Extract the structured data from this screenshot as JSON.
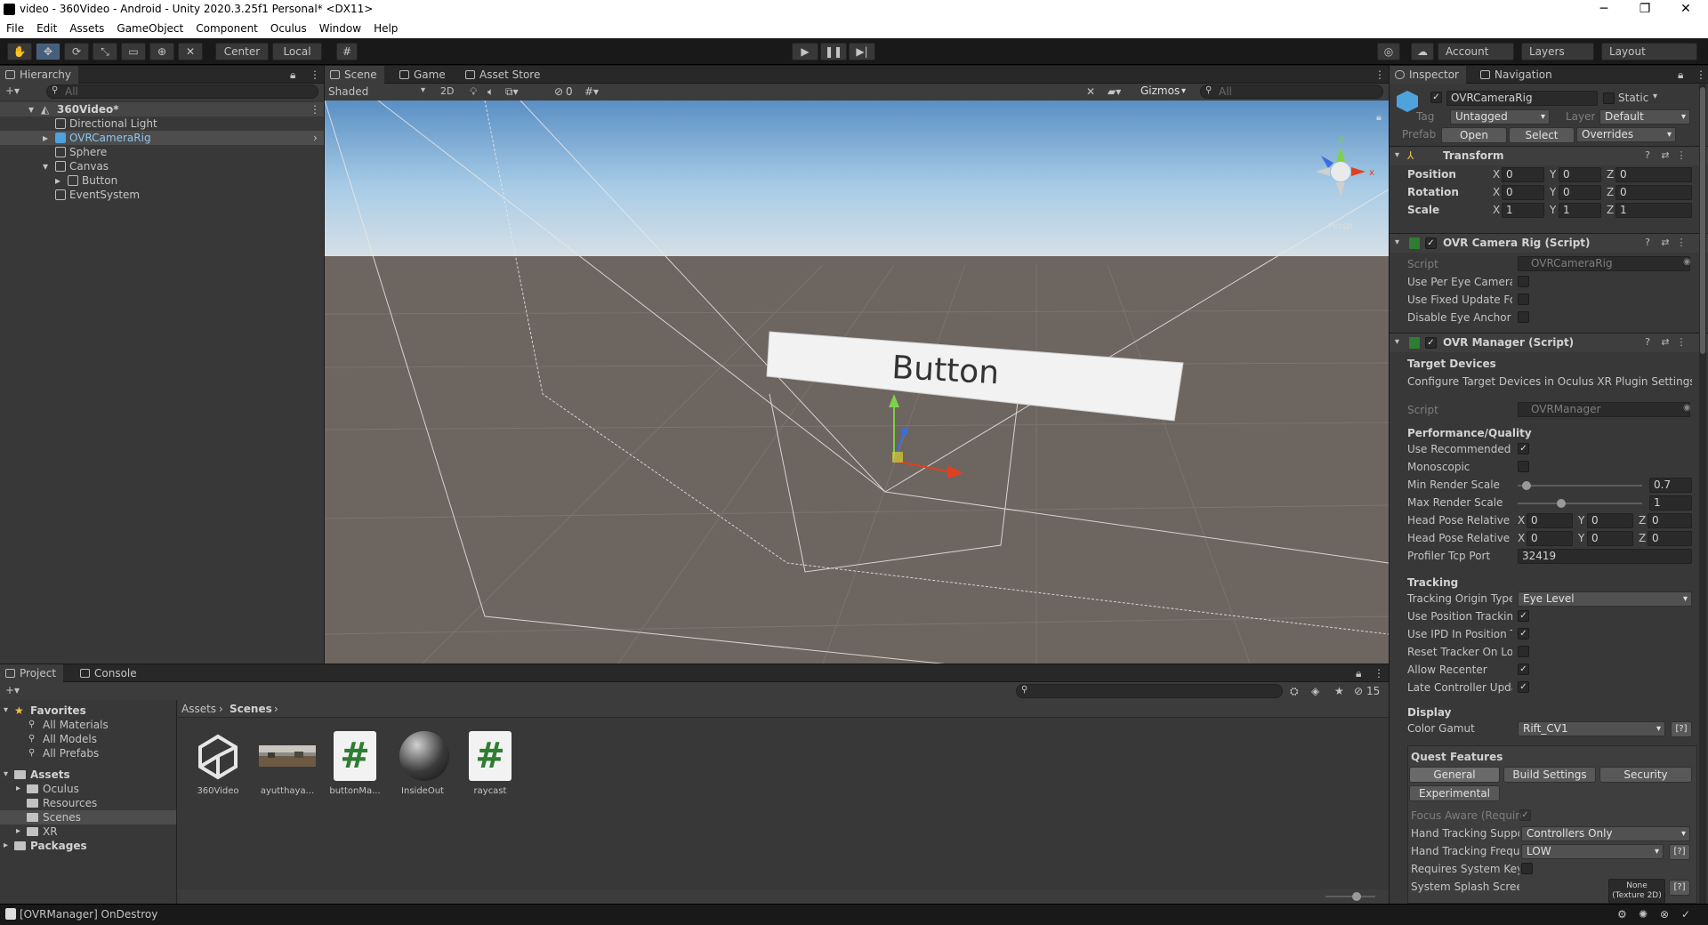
{
  "window": {
    "title": "video - 360Video - Android - Unity 2020.3.25f1 Personal* <DX11>",
    "minimize": "─",
    "maximize": "❐",
    "close": "✕"
  },
  "menu": [
    "File",
    "Edit",
    "Assets",
    "GameObject",
    "Component",
    "Oculus",
    "Window",
    "Help"
  ],
  "toolbar": {
    "pivot": "Center",
    "space": "Local",
    "account": "Account",
    "layers": "Layers",
    "layout": "Layout"
  },
  "hierarchy": {
    "tab": "Hierarchy",
    "search_placeholder": "All",
    "scene": "360Video*",
    "items": [
      "Directional Light",
      "OVRCameraRig",
      "Sphere",
      "Canvas",
      "Button",
      "EventSystem"
    ]
  },
  "scene_view": {
    "tabs": [
      "Scene",
      "Game",
      "Asset Store"
    ],
    "shading": "Shaded",
    "mode2d": "2D",
    "hidden_count": "0",
    "gizmos": "Gizmos",
    "search_placeholder": "All",
    "persp": "Persp",
    "button_text": "Button"
  },
  "inspector": {
    "tabs": [
      "Inspector",
      "Navigation"
    ],
    "object_name": "OVRCameraRig",
    "static_label": "Static",
    "tag_label": "Tag",
    "tag": "Untagged",
    "layer_label": "Layer",
    "layer": "Default",
    "prefab_label": "Prefab",
    "prefab_open": "Open",
    "prefab_select": "Select",
    "prefab_overrides": "Overrides",
    "transform": {
      "title": "Transform",
      "rows": [
        {
          "label": "Position",
          "x": "0",
          "y": "0",
          "z": "0"
        },
        {
          "label": "Rotation",
          "x": "0",
          "y": "0",
          "z": "0"
        },
        {
          "label": "Scale",
          "x": "1",
          "y": "1",
          "z": "1"
        }
      ]
    },
    "camera_rig": {
      "title": "OVR Camera Rig (Script)",
      "script_label": "Script",
      "script": "OVRCameraRig",
      "fields": [
        "Use Per Eye Cameras",
        "Use Fixed Update For",
        "Disable Eye Anchor C"
      ]
    },
    "ovr_manager": {
      "title": "OVR Manager (Script)",
      "target_devices": "Target Devices",
      "target_note": "Configure Target Devices in Oculus XR Plugin Settings.",
      "script_label": "Script",
      "script": "OVRManager",
      "perf_header": "Performance/Quality",
      "use_recommended": "Use Recommended M",
      "monoscopic": "Monoscopic",
      "min_render": "Min Render Scale",
      "min_render_value": "0.7",
      "min_render_level": 0.07,
      "max_render": "Max Render Scale",
      "max_render_value": "1",
      "max_render_level": 0.35,
      "head_pose1": "Head Pose Relative C",
      "head_pose2": "Head Pose Relative C",
      "hp1": {
        "x": "0",
        "y": "0",
        "z": "0"
      },
      "hp2": {
        "x": "0",
        "y": "0",
        "z": "0"
      },
      "profiler": "Profiler Tcp Port",
      "profiler_value": "32419",
      "tracking_header": "Tracking",
      "origin": "Tracking Origin Type",
      "origin_value": "Eye Level",
      "use_position": "Use Position Tracking",
      "use_ipd": "Use IPD In Position Tr",
      "reset_tracker": "Reset Tracker On Loa",
      "allow_recenter": "Allow Recenter",
      "late_controller": "Late Controller Updat",
      "display_header": "Display",
      "color_gamut": "Color Gamut",
      "color_gamut_value": "Rift_CV1",
      "help_btn": "[?]",
      "quest_header": "Quest Features",
      "quest_tabs": [
        "General",
        "Build Settings",
        "Security",
        "Experimental"
      ],
      "focus_aware": "Focus Aware (Require",
      "hand_support": "Hand Tracking Suppo",
      "hand_support_value": "Controllers Only",
      "hand_freq": "Hand Tracking Frequ",
      "hand_freq_value": "LOW",
      "requires_key": "Requires System Key",
      "splash": "System Splash Scree",
      "splash_value": "None (Texture 2D)"
    }
  },
  "project": {
    "tabs": [
      "Project",
      "Console"
    ],
    "hidden_count": "15",
    "favorites_label": "Favorites",
    "favorites": [
      "All Materials",
      "All Models",
      "All Prefabs"
    ],
    "assets_label": "Assets",
    "folders": [
      "Oculus",
      "Resources",
      "Scenes",
      "XR"
    ],
    "packages": "Packages",
    "breadcrumb": [
      "Assets",
      "Scenes"
    ],
    "assets": [
      {
        "name": "360Video",
        "icon": "unity-scene-icon"
      },
      {
        "name": "ayutthaya...",
        "icon": "image-thumbnail"
      },
      {
        "name": "buttonMa...",
        "icon": "csharp-script-icon"
      },
      {
        "name": "InsideOut",
        "icon": "material-sphere-icon"
      },
      {
        "name": "raycast",
        "icon": "csharp-script-icon"
      }
    ]
  },
  "status": {
    "message": "[OVRManager] OnDestroy"
  },
  "colors": {
    "scene_sky": "#9ec7e6",
    "scene_ground": "#6d6560",
    "accent_select": "#2c5d87",
    "script_green": "#2f7d32"
  }
}
